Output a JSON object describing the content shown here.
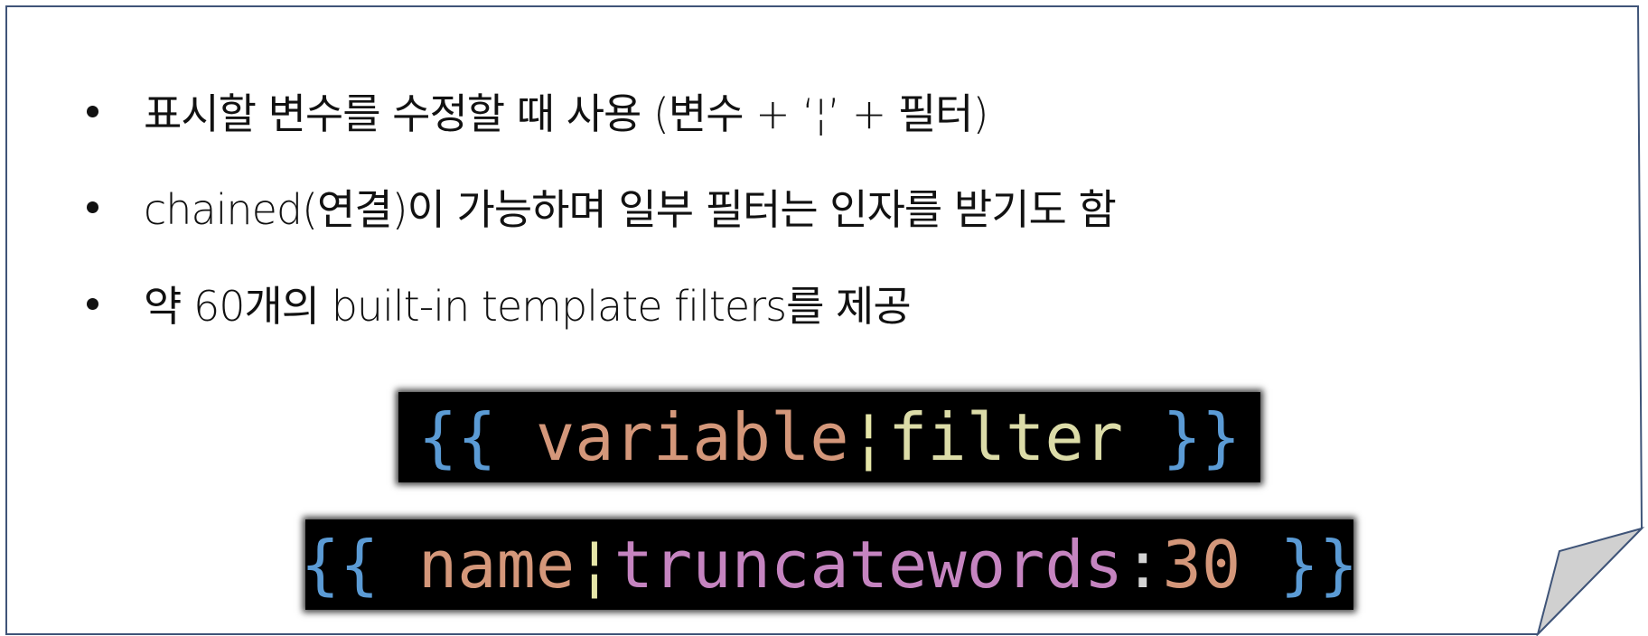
{
  "bullets": [
    "표시할 변수를 수정할 때 사용 (변수 + ‘¦’ + 필터)",
    "chained(연결)이 가능하며 일부 필터는 인자를 받기도 함",
    "약 60개의 built-in template filters를 제공"
  ],
  "code_examples": [
    {
      "open": "{{",
      "variable": "variable",
      "pipe": "¦",
      "filter": "filter",
      "close": "}}"
    },
    {
      "open": "{{",
      "variable": "name",
      "pipe": "¦",
      "filter": "truncatewords",
      "colon": ":",
      "argument": "30",
      "close": "}}"
    }
  ],
  "colors": {
    "text": "#111111",
    "frame_border": "#3f5478",
    "page_curl_fill": "#d0d0d0",
    "code_background": "#000000",
    "brace": "#5b9bd5",
    "variable": "#d4977a",
    "pipe": "#e6e6a8",
    "filter_plain": "#dcdca8",
    "filter_method": "#c584c0",
    "colon": "#d4d4d4",
    "number": "#d4977a"
  }
}
